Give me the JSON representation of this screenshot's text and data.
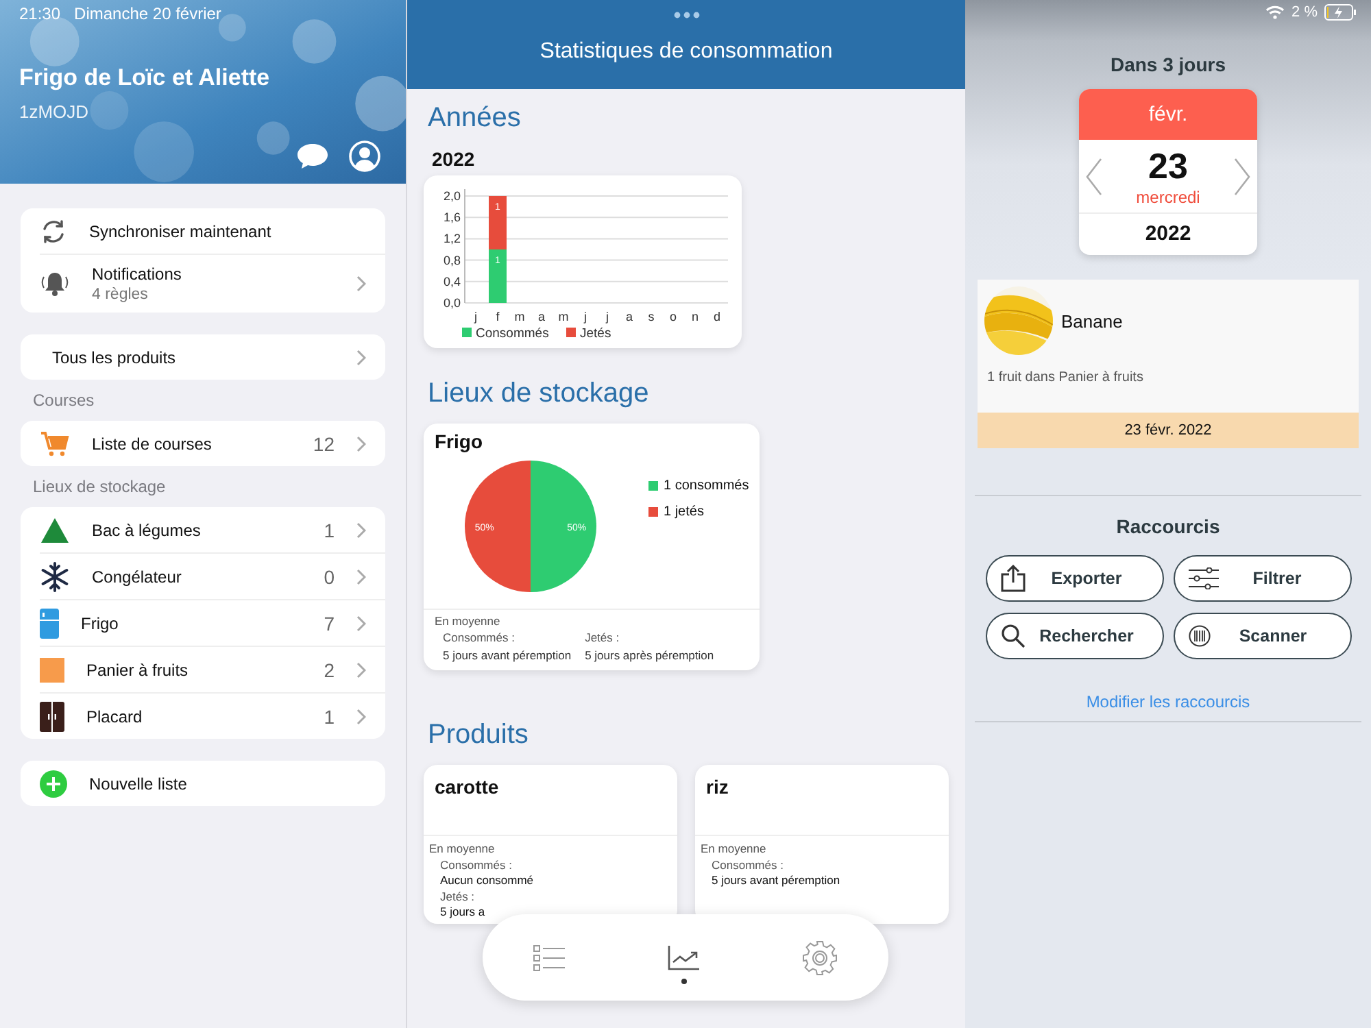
{
  "status_bar": {
    "time": "21:30",
    "date": "Dimanche 20 février",
    "battery": "2 %"
  },
  "sidebar": {
    "title": "Frigo de Loïc et Aliette",
    "code": "1zMOJD",
    "sync": {
      "label": "Synchroniser maintenant"
    },
    "notifications": {
      "label": "Notifications",
      "detail": "4 règles"
    },
    "all_products": "Tous les produits",
    "courses_header": "Courses",
    "shopping": {
      "label": "Liste de courses",
      "count": "12"
    },
    "storage_header": "Lieux de stockage",
    "storage": [
      {
        "label": "Bac à légumes",
        "count": "1"
      },
      {
        "label": "Congélateur",
        "count": "0"
      },
      {
        "label": "Frigo",
        "count": "7"
      },
      {
        "label": "Panier à fruits",
        "count": "2"
      },
      {
        "label": "Placard",
        "count": "1"
      }
    ],
    "new_list": "Nouvelle liste"
  },
  "stats": {
    "title": "Statistiques de consommation",
    "years_header": "Années",
    "year": "2022",
    "chart_data": {
      "type": "bar",
      "stacked": true,
      "categories": [
        "j",
        "f",
        "m",
        "a",
        "m",
        "j",
        "j",
        "a",
        "s",
        "o",
        "n",
        "d"
      ],
      "series": [
        {
          "name": "Consommés",
          "color": "#2ecc71",
          "values": [
            0,
            1,
            0,
            0,
            0,
            0,
            0,
            0,
            0,
            0,
            0,
            0
          ],
          "value_labels": [
            null,
            "1",
            null,
            null,
            null,
            null,
            null,
            null,
            null,
            null,
            null,
            null
          ]
        },
        {
          "name": "Jetés",
          "color": "#e74c3c",
          "values": [
            0,
            1,
            0,
            0,
            0,
            0,
            0,
            0,
            0,
            0,
            0,
            0
          ],
          "value_labels": [
            null,
            "1",
            null,
            null,
            null,
            null,
            null,
            null,
            null,
            null,
            null,
            null
          ]
        }
      ],
      "ylim": [
        0,
        2
      ],
      "yticks": [
        {
          "value": 0,
          "label": "0,0"
        },
        {
          "value": 0.4,
          "label": "0,4"
        },
        {
          "value": 0.8,
          "label": "0,8"
        },
        {
          "value": 1.2,
          "label": "1,2"
        },
        {
          "value": 1.6,
          "label": "1,6"
        },
        {
          "value": 2,
          "label": "2,0"
        }
      ],
      "grid": true,
      "legend": "bottom"
    },
    "storage_header": "Lieux de stockage",
    "storage_card": {
      "title": "Frigo",
      "chart_data": {
        "type": "pie",
        "categories": [
          "1 consommés",
          "1 jetés"
        ],
        "values": [
          50,
          50
        ],
        "colors": [
          "#2ecc71",
          "#e74c3c"
        ],
        "value_labels": [
          "50%",
          "50%"
        ]
      },
      "average": "En moyenne",
      "consumed_label": "Consommés :",
      "consumed": "5 jours avant péremption",
      "thrown_label": "Jetés :",
      "thrown": "5 jours après péremption"
    },
    "products_header": "Produits",
    "products": [
      {
        "name": "carotte",
        "average": "En moyenne",
        "lines": [
          "Consommés :",
          "Aucun consommé",
          "Jetés :",
          "5 jours a"
        ]
      },
      {
        "name": "riz",
        "average": "En moyenne",
        "lines": [
          "Consommés :",
          "5 jours avant péremption"
        ]
      }
    ]
  },
  "tab_bar": [
    {
      "selected": false
    },
    {
      "selected": true
    },
    {
      "selected": false
    }
  ],
  "detail": {
    "heading": "Dans 3 jours",
    "month": "févr.",
    "day": "23",
    "weekday": "mercredi",
    "year": "2022",
    "item": {
      "name": "Banane",
      "detail": "1 fruit dans Panier à fruits",
      "date": "23 févr. 2022"
    },
    "shortcuts_header": "Raccourcis",
    "shortcuts": [
      "Exporter",
      "Filtrer",
      "Rechercher",
      "Scanner"
    ],
    "edit_link": "Modifier les raccourcis"
  }
}
